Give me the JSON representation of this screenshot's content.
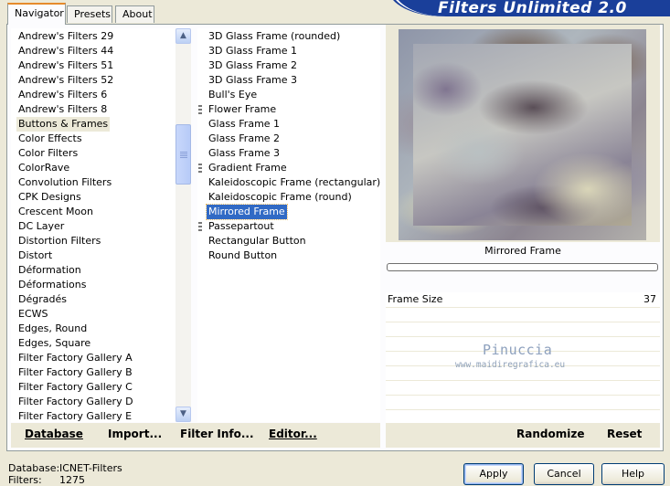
{
  "tabs": [
    {
      "label": "Navigator"
    },
    {
      "label": "Presets"
    },
    {
      "label": "About"
    }
  ],
  "banner": {
    "title": "Filters Unlimited 2.0"
  },
  "categories": {
    "items": [
      "Andrew's Filters 29",
      "Andrew's Filters 44",
      "Andrew's Filters 51",
      "Andrew's Filters 52",
      "Andrew's Filters 6",
      "Andrew's Filters 8",
      "Buttons & Frames",
      "Color Effects",
      "Color Filters",
      "ColorRave",
      "Convolution Filters",
      "CPK Designs",
      "Crescent Moon",
      "DC Layer",
      "Distortion Filters",
      "Distort",
      "Déformation",
      "Déformations",
      "Dégradés",
      "ECWS",
      "Edges, Round",
      "Edges, Square",
      "Filter Factory Gallery A",
      "Filter Factory Gallery B",
      "Filter Factory Gallery C",
      "Filter Factory Gallery D",
      "Filter Factory Gallery E"
    ],
    "selected": "Buttons & Frames"
  },
  "filters": {
    "items": [
      {
        "label": "3D Glass Frame (rounded)",
        "bullet": false
      },
      {
        "label": "3D Glass Frame 1",
        "bullet": false
      },
      {
        "label": "3D Glass Frame 2",
        "bullet": false
      },
      {
        "label": "3D Glass Frame 3",
        "bullet": false
      },
      {
        "label": "Bull's Eye",
        "bullet": false
      },
      {
        "label": "Flower Frame",
        "bullet": true
      },
      {
        "label": "Glass Frame 1",
        "bullet": false
      },
      {
        "label": "Glass Frame 2",
        "bullet": false
      },
      {
        "label": "Glass Frame 3",
        "bullet": false
      },
      {
        "label": "Gradient Frame",
        "bullet": true
      },
      {
        "label": "Kaleidoscopic Frame (rectangular)",
        "bullet": false
      },
      {
        "label": "Kaleidoscopic Frame (round)",
        "bullet": false
      },
      {
        "label": "Mirrored Frame",
        "bullet": false
      },
      {
        "label": "Passepartout",
        "bullet": true
      },
      {
        "label": "Rectangular Button",
        "bullet": false
      },
      {
        "label": "Round Button",
        "bullet": false
      }
    ],
    "selected": "Mirrored Frame"
  },
  "toolbar": {
    "database": "Database",
    "import": "Import...",
    "filter_info": "Filter Info...",
    "editor": "Editor...",
    "randomize": "Randomize",
    "reset": "Reset"
  },
  "preview": {
    "filter_name": "Mirrored Frame"
  },
  "params": [
    {
      "label": "Frame Size",
      "value": "37"
    }
  ],
  "watermark": {
    "name": "Pinuccia",
    "url": "www.maidiregrafica.eu"
  },
  "status": {
    "database_label": "Database:",
    "database_value": "ICNET-Filters",
    "filters_label": "Filters:",
    "filters_value": "1275"
  },
  "dialog": {
    "apply": "Apply",
    "cancel": "Cancel",
    "help": "Help"
  }
}
